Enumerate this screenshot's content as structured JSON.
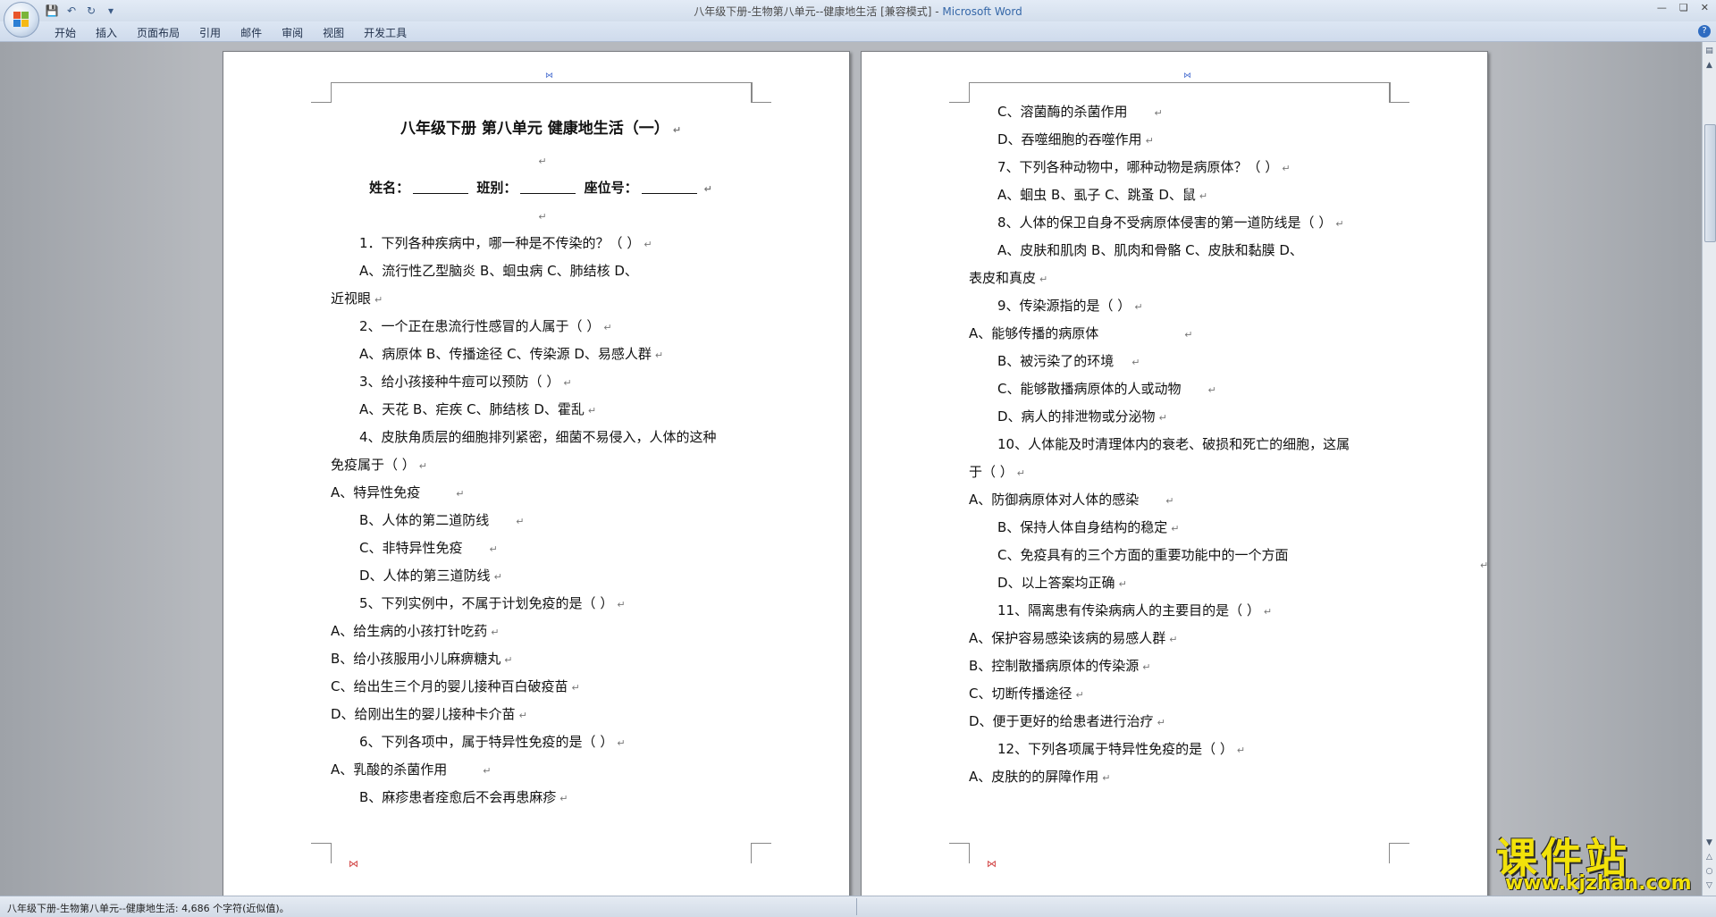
{
  "window": {
    "title_doc": "八年级下册-生物第八单元--健康地生活 [兼容模式]",
    "title_sep": " - ",
    "title_app": "Microsoft Word"
  },
  "ribbon": {
    "tabs": [
      "开始",
      "插入",
      "页面布局",
      "引用",
      "邮件",
      "审阅",
      "视图",
      "开发工具"
    ]
  },
  "page_left": {
    "title": "八年级下册  第八单元    健康地生活（一）",
    "name_label": "姓名：",
    "class_label": "班别：",
    "seat_label": "座位号：",
    "lines": [
      "1．下列各种疾病中，哪一种是不传染的？（      ）",
      "A、流行性乙型脑炎        B、蛔虫病        C、肺结核        D、",
      "近视眼",
      "2、一个正在患流行性感冒的人属于（      ）",
      "A、病原体    B、传播途径    C、传染源    D、易感人群",
      "3、给小孩接种牛痘可以预防（      ）",
      "A、天花      B、疟疾      C、肺结核      D、霍乱",
      "4、皮肤角质层的细胞排列紧密，细菌不易侵入，人体的这种",
      "免疫属于（      ）",
      "A、特异性免疫",
      "B、人体的第二道防线",
      "C、非特异性免疫",
      "D、人体的第三道防线",
      "5、下列实例中，不属于计划免疫的是（      ）",
      "A、给生病的小孩打针吃药",
      "B、给小孩服用小儿麻痹糖丸",
      "C、给出生三个月的婴儿接种百白破疫苗",
      "D、给刚出生的婴儿接种卡介苗",
      "6、下列各项中，属于特异性免疫的是（      ）",
      "A、乳酸的杀菌作用",
      "B、麻疹患者痊愈后不会再患麻疹"
    ]
  },
  "page_right": {
    "lines": [
      "C、溶菌酶的杀菌作用",
      "D、吞噬细胞的吞噬作用",
      "7、下列各种动物中，哪种动物是病原体？（      ）",
      "A、蛔虫      B、虱子      C、跳蚤      D、鼠",
      "8、人体的保卫自身不受病原体侵害的第一道防线是（      ）",
      "A、皮肤和肌肉      B、肌肉和骨骼      C、皮肤和黏膜      D、",
      "表皮和真皮",
      "9、传染源指的是（      ）",
      "A、能够传播的病原体",
      "B、被污染了的环境",
      "C、能够散播病原体的人或动物",
      "D、病人的排泄物或分泌物",
      "10、人体能及时清理体内的衰老、破损和死亡的细胞，这属",
      "于（      ）",
      "A、防御病原体对人体的感染",
      "B、保持人体自身结构的稳定",
      "C、免疫具有的三个方面的重要功能中的一个方面",
      "D、以上答案均正确",
      "11、隔离患有传染病病人的主要目的是（      ）",
      "A、保护容易感染该病的易感人群",
      "B、控制散播病原体的传染源",
      "C、切断传播途径",
      "D、便于更好的给患者进行治疗",
      "12、下列各项属于特异性免疫的是（      ）",
      "A、皮肤的的屏障作用"
    ]
  },
  "paragraph_mark": "↵",
  "statusbar": {
    "text": "八年级下册-生物第八单元--健康地生活: 4,686 个字符(近似值)。"
  },
  "watermark": {
    "main": "课件站",
    "sub": "www.kjzhan.com"
  }
}
